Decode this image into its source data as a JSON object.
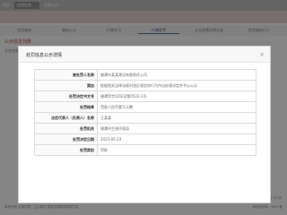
{
  "topnav": {
    "tabs": [
      "首页",
      "信用信息",
      "行政公示"
    ]
  },
  "subtabs": [
    "信用查询",
    "政务公示",
    "行政许可",
    "行政处罚",
    "企业经营异常名录",
    "失信被执行人"
  ],
  "background": {
    "section_title": "公示信息列表",
    "left_label": "企业名称",
    "footer_left": "版权所有 信用中国 · 主办单位 国家发展和改革委员会",
    "footer_right": "网站标识码 · 京ICP备",
    "page_hint": "第1页 共1页"
  },
  "modal": {
    "title": "处罚信息公示详情",
    "close_glyph": "×",
    "rows": [
      {
        "label": "被处罚人名称",
        "value": "湘潭市某某建设有限责任公司"
      },
      {
        "label": "案由",
        "value": "依据相关法律法规对违反规定的行为作出处理决定并予以公示"
      },
      {
        "label": "处罚决定书文号",
        "value": "湘潭罚字[2023]第0523-1号"
      },
      {
        "label": "处罚结果",
        "value": "罚款人民币壹万元整"
      },
      {
        "label": "法定代表人（负责人）名称",
        "value": "王某某"
      },
      {
        "label": "处罚机关",
        "value": "湘潭市生态环境局"
      },
      {
        "label": "处罚决定日期",
        "value": "2023-05-23"
      },
      {
        "label": "处罚类别",
        "value": "罚款"
      }
    ]
  }
}
